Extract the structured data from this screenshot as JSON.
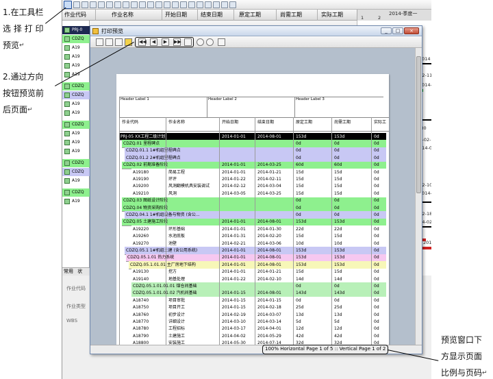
{
  "annotations": {
    "step1": [
      "1.在工具栏",
      "选 择 打 印",
      "预览"
    ],
    "step2": [
      "2.通过方向",
      "按钮预览前",
      "后页面"
    ],
    "step3": [
      "预览窗口下",
      "方显示页面",
      "比例与页码"
    ],
    "mark": "↵"
  },
  "app": {
    "columns": [
      "作业代码",
      "作业名称",
      "开始日期",
      "结束日期",
      "原定工期",
      "尚需工期",
      "实际工期"
    ],
    "gantt_header": "2014-季度一",
    "gantt_sub": [
      "1",
      "2"
    ],
    "gantt_dates": [
      "2014",
      "-02-11",
      "2014-",
      "-30",
      "2014-02-20",
      "2014-03",
      "-02-10",
      "2014-",
      "-02-18",
      "2014-02-",
      "201"
    ],
    "tree_codes": [
      "PRJ-0",
      "CDZQ",
      "A19",
      "A19",
      "A19",
      "A19",
      "CDZQ",
      "CDZQ",
      "A19",
      "A19",
      "CDZQ",
      "A19",
      "A19",
      "A19",
      "CDZQ",
      "CDZQ",
      "A19",
      "CDZQ",
      "A19"
    ],
    "tabs": [
      "常用",
      "状"
    ],
    "detail_labels": [
      "作业代码",
      "作业类型",
      "WBS"
    ]
  },
  "preview": {
    "title": "打印预览",
    "window_buttons": [
      "_",
      "□",
      "×"
    ],
    "nav_buttons": [
      "◀◀",
      "◀",
      "▶",
      "▶▶"
    ],
    "header_labels": [
      "Header Label 1",
      "Header Label 2",
      "Header Label 3"
    ],
    "columns": [
      "作业代码",
      "作业名称",
      "开始日期",
      "结束日期",
      "原定工期",
      "尚需工期",
      "实际工"
    ],
    "status": "100%  Horizontal Page 1 of 5 :: Vertical Page 1 of 2",
    "rows": [
      {
        "code": "PRJ-05  XX工程二级计划",
        "name": "",
        "start": "2014-01-01",
        "end": "2014-08-01",
        "dur": "153d",
        "remain": "153d",
        "actual": "0d",
        "level": "project"
      },
      {
        "code": "CDZQ.01  里程碑点",
        "name": "",
        "start": "",
        "end": "",
        "dur": "0d",
        "remain": "0d",
        "actual": "0d",
        "level": "wbs1"
      },
      {
        "code": "CDZQ.01.1  1#机组里程碑点",
        "name": "",
        "start": "",
        "end": "",
        "dur": "0d",
        "remain": "0d",
        "actual": "0d",
        "level": "wbs2"
      },
      {
        "code": "CDZQ.01.2  2#机组里程碑点",
        "name": "",
        "start": "",
        "end": "",
        "dur": "0d",
        "remain": "0d",
        "actual": "0d",
        "level": "wbs2"
      },
      {
        "code": "CDZQ.02  前期准备阶段",
        "name": "",
        "start": "2014-01-01",
        "end": "2014-03-25",
        "dur": "60d",
        "remain": "60d",
        "actual": "0d",
        "level": "wbs1"
      },
      {
        "code": "A19180",
        "name": "简易工程",
        "start": "2014-01-01",
        "end": "2014-01-21",
        "dur": "15d",
        "remain": "15d",
        "actual": "0d",
        "level": "task"
      },
      {
        "code": "A19190",
        "name": "环评",
        "start": "2014-01-22",
        "end": "2014-02-11",
        "dur": "15d",
        "remain": "15d",
        "actual": "0d",
        "level": "task"
      },
      {
        "code": "A19200",
        "name": "风洞翻模机具安装调试",
        "start": "2014-02-12",
        "end": "2014-03-04",
        "dur": "15d",
        "remain": "15d",
        "actual": "0d",
        "level": "task"
      },
      {
        "code": "A19210",
        "name": "风洞",
        "start": "2014-03-05",
        "end": "2014-03-25",
        "dur": "15d",
        "remain": "15d",
        "actual": "0d",
        "level": "task"
      },
      {
        "code": "CDZQ.03  图纸设计阶段",
        "name": "",
        "start": "",
        "end": "",
        "dur": "0d",
        "remain": "0d",
        "actual": "0d",
        "level": "wbs1"
      },
      {
        "code": "CDZQ.04  物资采购阶段",
        "name": "",
        "start": "",
        "end": "",
        "dur": "0d",
        "remain": "0d",
        "actual": "0d",
        "level": "wbs1"
      },
      {
        "code": "CDZQ.04.1  1#机组设备与物资 (含公...",
        "name": "",
        "start": "",
        "end": "",
        "dur": "0d",
        "remain": "0d",
        "actual": "0d",
        "level": "wbs2"
      },
      {
        "code": "CDZQ.05  土建施工阶段",
        "name": "",
        "start": "2014-01-01",
        "end": "2014-08-01",
        "dur": "153d",
        "remain": "153d",
        "actual": "0d",
        "level": "wbs1"
      },
      {
        "code": "A19220",
        "name": "环形基础",
        "start": "2014-01-01",
        "end": "2014-01-30",
        "dur": "22d",
        "remain": "22d",
        "actual": "0d",
        "level": "task"
      },
      {
        "code": "A19260",
        "name": "水池底板",
        "start": "2014-01-31",
        "end": "2014-02-20",
        "dur": "15d",
        "remain": "15d",
        "actual": "0d",
        "level": "task"
      },
      {
        "code": "A19270",
        "name": "池壁",
        "start": "2014-02-21",
        "end": "2014-03-06",
        "dur": "10d",
        "remain": "10d",
        "actual": "0d",
        "level": "task"
      },
      {
        "code": "CDZQ.05.1  1#机组土建 (含公用系统)",
        "name": "",
        "start": "2014-01-01",
        "end": "2014-08-01",
        "dur": "153d",
        "remain": "153d",
        "actual": "0d",
        "level": "wbs2"
      },
      {
        "code": "CDZQ.05.1.01  热力系统",
        "name": "",
        "start": "2014-01-01",
        "end": "2014-08-01",
        "dur": "153d",
        "remain": "153d",
        "actual": "0d",
        "level": "wbs3"
      },
      {
        "code": "CDZQ.05.1.01.01  主厂房地下结构",
        "name": "",
        "start": "2014-01-01",
        "end": "2014-08-01",
        "dur": "153d",
        "remain": "153d",
        "actual": "0d",
        "level": "wbs4"
      },
      {
        "code": "A19130",
        "name": "挖方",
        "start": "2014-01-01",
        "end": "2014-01-21",
        "dur": "15d",
        "remain": "15d",
        "actual": "0d",
        "level": "task"
      },
      {
        "code": "A19140",
        "name": "地基处理",
        "start": "2014-01-22",
        "end": "2014-02-10",
        "dur": "14d",
        "remain": "14d",
        "actual": "0d",
        "level": "task"
      },
      {
        "code": "CDZQ.05.1.01.01.01  煤仓间基础",
        "name": "",
        "start": "",
        "end": "",
        "dur": "0d",
        "remain": "0d",
        "actual": "0d",
        "level": "wbs5"
      },
      {
        "code": "CDZQ.05.1.01.01.02  汽机间基础",
        "name": "",
        "start": "2014-01-15",
        "end": "2014-08-01",
        "dur": "143d",
        "remain": "143d",
        "actual": "0d",
        "level": "wbs5"
      },
      {
        "code": "A18740",
        "name": "项目审批",
        "start": "2014-01-15",
        "end": "2014-01-15",
        "dur": "0d",
        "remain": "0d",
        "actual": "0d",
        "level": "task"
      },
      {
        "code": "A18750",
        "name": "项目开工",
        "start": "2014-01-15",
        "end": "2014-02-18",
        "dur": "25d",
        "remain": "25d",
        "actual": "0d",
        "level": "task"
      },
      {
        "code": "A18760",
        "name": "初步设计",
        "start": "2014-02-19",
        "end": "2014-03-07",
        "dur": "13d",
        "remain": "13d",
        "actual": "0d",
        "level": "task"
      },
      {
        "code": "A18770",
        "name": "详细设计",
        "start": "2014-03-10",
        "end": "2014-03-14",
        "dur": "5d",
        "remain": "5d",
        "actual": "0d",
        "level": "task"
      },
      {
        "code": "A18780",
        "name": "工程招标",
        "start": "2014-03-17",
        "end": "2014-04-01",
        "dur": "12d",
        "remain": "12d",
        "actual": "0d",
        "level": "task"
      },
      {
        "code": "A18790",
        "name": "土建施工",
        "start": "2014-04-02",
        "end": "2014-05-29",
        "dur": "42d",
        "remain": "42d",
        "actual": "0d",
        "level": "task"
      },
      {
        "code": "A18800",
        "name": "安装施工",
        "start": "2014-05-30",
        "end": "2014-07-14",
        "dur": "32d",
        "remain": "32d",
        "actual": "0d",
        "level": "task"
      }
    ]
  },
  "colors": {
    "project": "#000000",
    "wbs1": "#8ef08e",
    "wbs2": "#c8c8f4",
    "wbs3": "#f6c8f0",
    "wbs4": "#f7f7b8",
    "wbs5": "#b8f0b8",
    "task": "#ffffff"
  }
}
